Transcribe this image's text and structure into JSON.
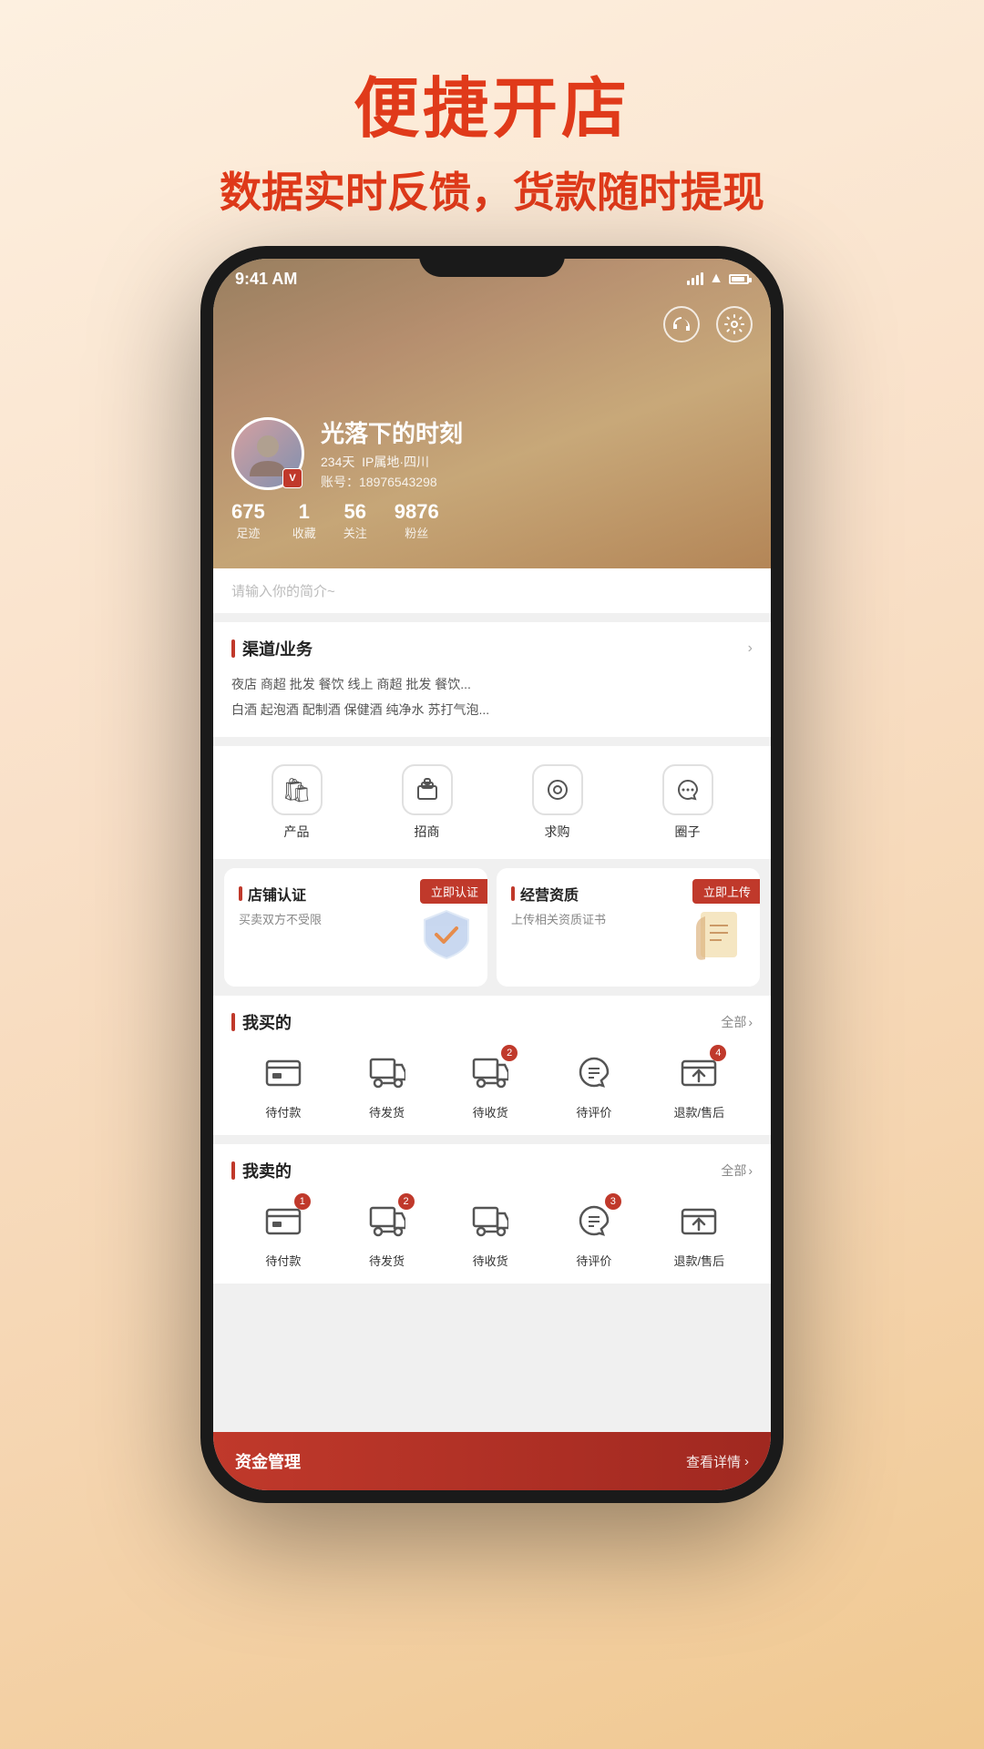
{
  "page": {
    "title_line1": "便捷开店",
    "title_line2": "数据实时反馈，货款随时提现"
  },
  "status_bar": {
    "time": "9:41 AM"
  },
  "user": {
    "name": "光落下的时刻",
    "days": "234天",
    "ip_location": "IP属地·四川",
    "account_label": "账号：",
    "account": "18976543298",
    "v_badge": "V",
    "avatar_emoji": "🙍‍♀️",
    "stats": [
      {
        "num": "675",
        "label": "足迹"
      },
      {
        "num": "1",
        "label": "收藏"
      },
      {
        "num": "56",
        "label": "关注"
      },
      {
        "num": "9876",
        "label": "粉丝"
      }
    ]
  },
  "header_icons": {
    "headset": "🎧",
    "gear": "⚙️"
  },
  "bio_placeholder": "请输入你的简介~",
  "channel": {
    "title": "渠道/业务",
    "tags_row1": "夜店  商超  批发  餐饮  线上  商超  批发  餐饮...",
    "tags_row2": "白酒  起泡酒  配制酒  保健酒  纯净水  苏打气泡..."
  },
  "quick_nav": [
    {
      "icon": "🛍",
      "label": "产品"
    },
    {
      "icon": "📋",
      "label": "招商"
    },
    {
      "icon": "🔍",
      "label": "求购"
    },
    {
      "icon": "💬",
      "label": "圈子"
    }
  ],
  "cert_cards": [
    {
      "title": "店铺认证",
      "badge": "立即认证",
      "desc": "买卖双方不受限",
      "icon": "🛡️"
    },
    {
      "title": "经营资质",
      "badge": "立即上传",
      "desc": "上传相关资质证书",
      "icon": "📜"
    }
  ],
  "my_purchases": {
    "title": "我买的",
    "view_all": "全部",
    "items": [
      {
        "icon": "💳",
        "label": "待付款",
        "badge": null
      },
      {
        "icon": "📦",
        "label": "待发货",
        "badge": null
      },
      {
        "icon": "🚚",
        "label": "待收货",
        "badge": "2"
      },
      {
        "icon": "💬",
        "label": "待评价",
        "badge": null
      },
      {
        "icon": "↩️",
        "label": "退款/售后",
        "badge": "4"
      }
    ]
  },
  "my_sales": {
    "title": "我卖的",
    "view_all": "全部",
    "items": [
      {
        "icon": "💳",
        "label": "待付款",
        "badge": "1"
      },
      {
        "icon": "📦",
        "label": "待发货",
        "badge": "2"
      },
      {
        "icon": "🚚",
        "label": "待收货",
        "badge": null
      },
      {
        "icon": "💬",
        "label": "待评价",
        "badge": "3"
      },
      {
        "icon": "↩️",
        "label": "退款/售后",
        "badge": null
      }
    ]
  },
  "bottom_bar": {
    "left_label": "资金管理",
    "right_label": "查看详情"
  }
}
